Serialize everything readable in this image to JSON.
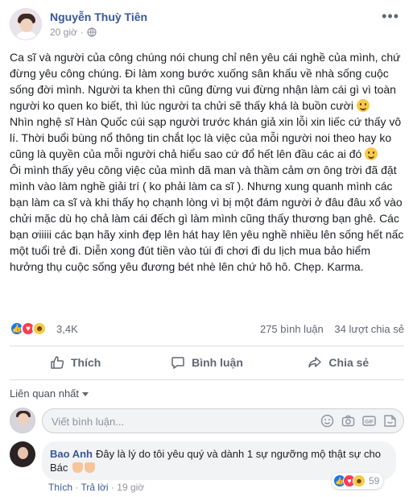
{
  "post": {
    "author": "Nguyễn Thuỳ Tiên",
    "time": "20 giờ",
    "more_icon": "•••",
    "paragraphs": [
      "Ca sĩ và người của công chúng nói chung chỉ nên yêu cái nghề của mình, chứ đừng yêu công chúng. Đi làm xong bước xuống sân khấu về nhà sống cuộc sống đời mình. Người ta khen thì cũng đừng vui đừng nhận làm cái gì vì toàn người ko quen ko biết, thì lúc người ta chửi sẽ thấy khá là buồn cười",
      "Nhìn nghệ sĩ Hàn Quốc cúi sạp người trước khán giả xin lỗi xin liếc cứ thấy vô lí. Thời buổi bùng nổ thông tin chắt lọc là việc của mỗi người noi theo hay ko cũng là quyền của mỗi người chả hiểu sao cứ đổ hết lên đầu các ai đó",
      "Ôi mình thấy yêu công việc của mình dã man và thầm cảm ơn ông trời đã đặt mình vào làm nghề giải trí ( ko phải làm ca sĩ ). Nhưng xung quanh mình các bạn làm ca sĩ và khi thấy họ chạnh lòng vì bị một đám người ở đâu đâu xổ vào chửi mặc dù họ chả làm cái đếch gì làm mình cũng thấy thương bạn ghê. Các bạn ơiiiii các bạn hãy xinh đẹp lên hát hay lên yêu nghề nhiều lên sống hết nấc một tuổi trẻ đi. Diễn xong đút tiền vào túi đi chơi đi du lịch mua bảo hiểm hưởng thụ cuộc sống yêu đương bét nhè lên chứ hô hô. Chẹp. Karma."
    ]
  },
  "reactions": {
    "count": "3,4K",
    "comments": "275 bình luận",
    "shares": "34 lượt chia sẻ"
  },
  "actions": {
    "like": "Thích",
    "comment": "Bình luận",
    "share": "Chia sẻ"
  },
  "filter": {
    "label": "Liên quan nhất"
  },
  "comment_input": {
    "placeholder": "Viết bình luận..."
  },
  "comment": {
    "author": "Bao Anh",
    "text": "Đây là lý do tôi yêu quý và dành 1 sự ngưỡng mộ thật sự cho Bác",
    "like": "Thích",
    "reply": "Trả lời",
    "time": "19 giờ",
    "reaction_count": "59"
  },
  "colors": {
    "link": "#385898",
    "like_blue": "#1877f2",
    "love_red": "#f33e58",
    "haha_yellow": "#f7c948"
  }
}
